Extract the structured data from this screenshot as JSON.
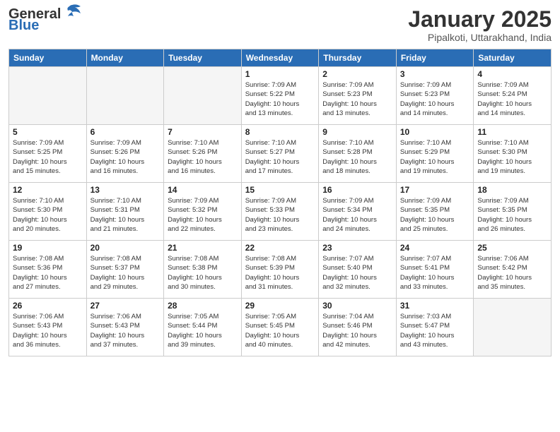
{
  "header": {
    "logo_line1": "General",
    "logo_line2": "Blue",
    "month_title": "January 2025",
    "location": "Pipalkoti, Uttarakhand, India"
  },
  "days_of_week": [
    "Sunday",
    "Monday",
    "Tuesday",
    "Wednesday",
    "Thursday",
    "Friday",
    "Saturday"
  ],
  "weeks": [
    [
      {
        "day": "",
        "info": ""
      },
      {
        "day": "",
        "info": ""
      },
      {
        "day": "",
        "info": ""
      },
      {
        "day": "1",
        "info": "Sunrise: 7:09 AM\nSunset: 5:22 PM\nDaylight: 10 hours\nand 13 minutes."
      },
      {
        "day": "2",
        "info": "Sunrise: 7:09 AM\nSunset: 5:23 PM\nDaylight: 10 hours\nand 13 minutes."
      },
      {
        "day": "3",
        "info": "Sunrise: 7:09 AM\nSunset: 5:23 PM\nDaylight: 10 hours\nand 14 minutes."
      },
      {
        "day": "4",
        "info": "Sunrise: 7:09 AM\nSunset: 5:24 PM\nDaylight: 10 hours\nand 14 minutes."
      }
    ],
    [
      {
        "day": "5",
        "info": "Sunrise: 7:09 AM\nSunset: 5:25 PM\nDaylight: 10 hours\nand 15 minutes."
      },
      {
        "day": "6",
        "info": "Sunrise: 7:09 AM\nSunset: 5:26 PM\nDaylight: 10 hours\nand 16 minutes."
      },
      {
        "day": "7",
        "info": "Sunrise: 7:10 AM\nSunset: 5:26 PM\nDaylight: 10 hours\nand 16 minutes."
      },
      {
        "day": "8",
        "info": "Sunrise: 7:10 AM\nSunset: 5:27 PM\nDaylight: 10 hours\nand 17 minutes."
      },
      {
        "day": "9",
        "info": "Sunrise: 7:10 AM\nSunset: 5:28 PM\nDaylight: 10 hours\nand 18 minutes."
      },
      {
        "day": "10",
        "info": "Sunrise: 7:10 AM\nSunset: 5:29 PM\nDaylight: 10 hours\nand 19 minutes."
      },
      {
        "day": "11",
        "info": "Sunrise: 7:10 AM\nSunset: 5:30 PM\nDaylight: 10 hours\nand 19 minutes."
      }
    ],
    [
      {
        "day": "12",
        "info": "Sunrise: 7:10 AM\nSunset: 5:30 PM\nDaylight: 10 hours\nand 20 minutes."
      },
      {
        "day": "13",
        "info": "Sunrise: 7:10 AM\nSunset: 5:31 PM\nDaylight: 10 hours\nand 21 minutes."
      },
      {
        "day": "14",
        "info": "Sunrise: 7:09 AM\nSunset: 5:32 PM\nDaylight: 10 hours\nand 22 minutes."
      },
      {
        "day": "15",
        "info": "Sunrise: 7:09 AM\nSunset: 5:33 PM\nDaylight: 10 hours\nand 23 minutes."
      },
      {
        "day": "16",
        "info": "Sunrise: 7:09 AM\nSunset: 5:34 PM\nDaylight: 10 hours\nand 24 minutes."
      },
      {
        "day": "17",
        "info": "Sunrise: 7:09 AM\nSunset: 5:35 PM\nDaylight: 10 hours\nand 25 minutes."
      },
      {
        "day": "18",
        "info": "Sunrise: 7:09 AM\nSunset: 5:35 PM\nDaylight: 10 hours\nand 26 minutes."
      }
    ],
    [
      {
        "day": "19",
        "info": "Sunrise: 7:08 AM\nSunset: 5:36 PM\nDaylight: 10 hours\nand 27 minutes."
      },
      {
        "day": "20",
        "info": "Sunrise: 7:08 AM\nSunset: 5:37 PM\nDaylight: 10 hours\nand 29 minutes."
      },
      {
        "day": "21",
        "info": "Sunrise: 7:08 AM\nSunset: 5:38 PM\nDaylight: 10 hours\nand 30 minutes."
      },
      {
        "day": "22",
        "info": "Sunrise: 7:08 AM\nSunset: 5:39 PM\nDaylight: 10 hours\nand 31 minutes."
      },
      {
        "day": "23",
        "info": "Sunrise: 7:07 AM\nSunset: 5:40 PM\nDaylight: 10 hours\nand 32 minutes."
      },
      {
        "day": "24",
        "info": "Sunrise: 7:07 AM\nSunset: 5:41 PM\nDaylight: 10 hours\nand 33 minutes."
      },
      {
        "day": "25",
        "info": "Sunrise: 7:06 AM\nSunset: 5:42 PM\nDaylight: 10 hours\nand 35 minutes."
      }
    ],
    [
      {
        "day": "26",
        "info": "Sunrise: 7:06 AM\nSunset: 5:43 PM\nDaylight: 10 hours\nand 36 minutes."
      },
      {
        "day": "27",
        "info": "Sunrise: 7:06 AM\nSunset: 5:43 PM\nDaylight: 10 hours\nand 37 minutes."
      },
      {
        "day": "28",
        "info": "Sunrise: 7:05 AM\nSunset: 5:44 PM\nDaylight: 10 hours\nand 39 minutes."
      },
      {
        "day": "29",
        "info": "Sunrise: 7:05 AM\nSunset: 5:45 PM\nDaylight: 10 hours\nand 40 minutes."
      },
      {
        "day": "30",
        "info": "Sunrise: 7:04 AM\nSunset: 5:46 PM\nDaylight: 10 hours\nand 42 minutes."
      },
      {
        "day": "31",
        "info": "Sunrise: 7:03 AM\nSunset: 5:47 PM\nDaylight: 10 hours\nand 43 minutes."
      },
      {
        "day": "",
        "info": ""
      }
    ]
  ]
}
